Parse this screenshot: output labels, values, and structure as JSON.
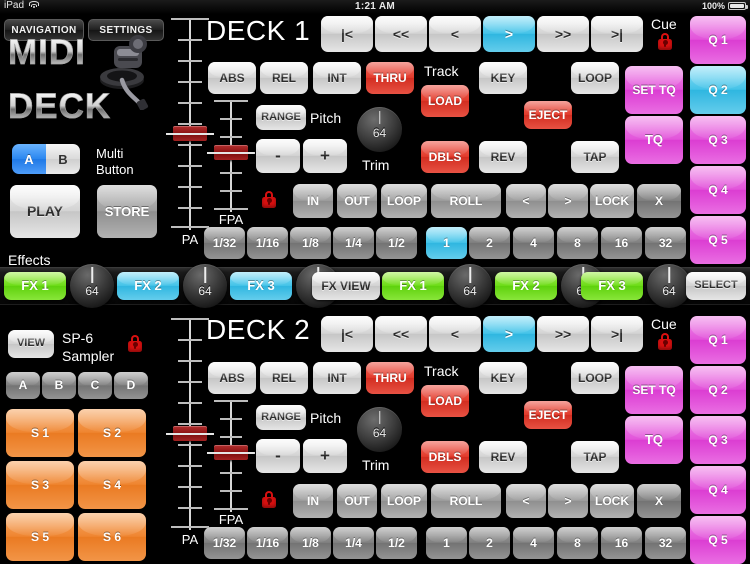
{
  "statusbar": {
    "device": "iPad",
    "time": "1:21 AM",
    "battery": "100%"
  },
  "topnav": {
    "navigation": "NAVIGATION",
    "settings": "SETTINGS"
  },
  "branding": {
    "line1": "MIDI",
    "line2": "DECK"
  },
  "multi": {
    "label_line1": "Multi",
    "label_line2": "Button",
    "seg_a": "A",
    "seg_b": "B",
    "play": "PLAY",
    "store": "STORE"
  },
  "effects_label": "Effects",
  "sampler": {
    "view": "VIEW",
    "title_line1": "SP-6",
    "title_line2": "Sampler",
    "banks": [
      "A",
      "B",
      "C",
      "D"
    ],
    "pads": [
      "S 1",
      "S 2",
      "S 3",
      "S 4",
      "S 5",
      "S 6"
    ]
  },
  "fx_rows": [
    {
      "id": "fx-row-deck1",
      "slots": [
        {
          "label": "FX 1",
          "color": "green",
          "knob": "64"
        },
        {
          "label": "FX 2",
          "color": "cyan",
          "knob": "64"
        },
        {
          "label": "FX 3",
          "color": "cyan",
          "knob": "64"
        }
      ],
      "action": "FX VIEW"
    },
    {
      "id": "fx-row-deck2",
      "slots": [
        {
          "label": "FX 1",
          "color": "green",
          "knob": "64"
        },
        {
          "label": "FX 2",
          "color": "green",
          "knob": "64"
        },
        {
          "label": "FX 3",
          "color": "green",
          "knob": "64"
        }
      ],
      "action": "SELECT"
    }
  ],
  "decks": [
    {
      "title": "DECK 1",
      "pa_label": "PA",
      "fpa_label": "FPA",
      "transport": [
        {
          "label": "|<",
          "color": "white"
        },
        {
          "label": "<<",
          "color": "white"
        },
        {
          "label": "<",
          "color": "white"
        },
        {
          "label": ">",
          "color": "cyan"
        },
        {
          "label": ">>",
          "color": "white"
        },
        {
          "label": ">|",
          "color": "white"
        }
      ],
      "modes": [
        {
          "label": "ABS",
          "color": "white"
        },
        {
          "label": "REL",
          "color": "white"
        },
        {
          "label": "INT",
          "color": "white"
        },
        {
          "label": "THRU",
          "color": "red"
        }
      ],
      "track_label": "Track",
      "load": "LOAD",
      "key": "KEY",
      "loop_top": "LOOP",
      "eject": "EJECT",
      "range": "RANGE",
      "pitch_label": "Pitch",
      "pitch_minus": "-",
      "pitch_plus": "+",
      "trim_label": "Trim",
      "trim_value": "64",
      "dbls": "DBLS",
      "rev": "REV",
      "tap": "TAP",
      "cue_label": "Cue",
      "set_tq": "SET TQ",
      "tq": "TQ",
      "loop_row": [
        {
          "label": "IN",
          "color": "grey"
        },
        {
          "label": "OUT",
          "color": "grey"
        },
        {
          "label": "LOOP",
          "color": "grey"
        },
        {
          "label": "ROLL",
          "color": "grey"
        },
        {
          "label": "<",
          "color": "grey"
        },
        {
          "label": ">",
          "color": "grey"
        },
        {
          "label": "LOCK",
          "color": "grey"
        },
        {
          "label": "X",
          "color": "dgrey"
        }
      ],
      "beats": [
        {
          "label": "1/32",
          "color": "dgrey"
        },
        {
          "label": "1/16",
          "color": "dgrey"
        },
        {
          "label": "1/8",
          "color": "dgrey"
        },
        {
          "label": "1/4",
          "color": "dgrey"
        },
        {
          "label": "1/2",
          "color": "dgrey"
        },
        {
          "label": "1",
          "color": "cyan"
        },
        {
          "label": "2",
          "color": "dgrey"
        },
        {
          "label": "4",
          "color": "dgrey"
        },
        {
          "label": "8",
          "color": "dgrey"
        },
        {
          "label": "16",
          "color": "dgrey"
        },
        {
          "label": "32",
          "color": "dgrey"
        }
      ],
      "cues": [
        {
          "label": "Q 1",
          "color": "magenta"
        },
        {
          "label": "Q 2",
          "color": "cyan"
        },
        {
          "label": "Q 3",
          "color": "magenta"
        },
        {
          "label": "Q 4",
          "color": "magenta"
        },
        {
          "label": "Q 5",
          "color": "magenta"
        }
      ]
    },
    {
      "title": "DECK 2",
      "pa_label": "PA",
      "fpa_label": "FPA",
      "transport": [
        {
          "label": "|<",
          "color": "white"
        },
        {
          "label": "<<",
          "color": "white"
        },
        {
          "label": "<",
          "color": "white"
        },
        {
          "label": ">",
          "color": "cyan"
        },
        {
          "label": ">>",
          "color": "white"
        },
        {
          "label": ">|",
          "color": "white"
        }
      ],
      "modes": [
        {
          "label": "ABS",
          "color": "white"
        },
        {
          "label": "REL",
          "color": "white"
        },
        {
          "label": "INT",
          "color": "white"
        },
        {
          "label": "THRU",
          "color": "red"
        }
      ],
      "track_label": "Track",
      "load": "LOAD",
      "key": "KEY",
      "loop_top": "LOOP",
      "eject": "EJECT",
      "range": "RANGE",
      "pitch_label": "Pitch",
      "pitch_minus": "-",
      "pitch_plus": "+",
      "trim_label": "Trim",
      "trim_value": "64",
      "dbls": "DBLS",
      "rev": "REV",
      "tap": "TAP",
      "cue_label": "Cue",
      "set_tq": "SET TQ",
      "tq": "TQ",
      "loop_row": [
        {
          "label": "IN",
          "color": "grey"
        },
        {
          "label": "OUT",
          "color": "grey"
        },
        {
          "label": "LOOP",
          "color": "grey"
        },
        {
          "label": "ROLL",
          "color": "grey"
        },
        {
          "label": "<",
          "color": "grey"
        },
        {
          "label": ">",
          "color": "grey"
        },
        {
          "label": "LOCK",
          "color": "grey"
        },
        {
          "label": "X",
          "color": "dgrey"
        }
      ],
      "beats": [
        {
          "label": "1/32",
          "color": "dgrey"
        },
        {
          "label": "1/16",
          "color": "dgrey"
        },
        {
          "label": "1/8",
          "color": "dgrey"
        },
        {
          "label": "1/4",
          "color": "dgrey"
        },
        {
          "label": "1/2",
          "color": "dgrey"
        },
        {
          "label": "1",
          "color": "dgrey"
        },
        {
          "label": "2",
          "color": "dgrey"
        },
        {
          "label": "4",
          "color": "dgrey"
        },
        {
          "label": "8",
          "color": "dgrey"
        },
        {
          "label": "16",
          "color": "dgrey"
        },
        {
          "label": "32",
          "color": "dgrey"
        }
      ],
      "cues": [
        {
          "label": "Q 1",
          "color": "magenta"
        },
        {
          "label": "Q 2",
          "color": "magenta"
        },
        {
          "label": "Q 3",
          "color": "magenta"
        },
        {
          "label": "Q 4",
          "color": "magenta"
        },
        {
          "label": "Q 5",
          "color": "magenta"
        }
      ]
    }
  ]
}
